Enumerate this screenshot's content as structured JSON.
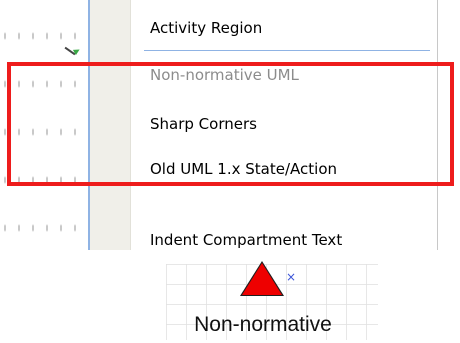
{
  "menu": {
    "items": [
      {
        "label": "Activity Region",
        "enabled": true
      },
      {
        "label": "Non-normative UML",
        "enabled": false
      },
      {
        "label": "Sharp Corners",
        "enabled": true
      },
      {
        "label": "Old UML 1.x State/Action",
        "enabled": true
      },
      {
        "label": "Indent Compartment Text",
        "enabled": true
      }
    ]
  },
  "highlight": {
    "color": "#ee1c1c"
  },
  "preview": {
    "label": "Non-normative",
    "shape_color": "#ee0000",
    "anchor_marker": "×"
  },
  "colors": {
    "accent": "#8fb3e4",
    "gutter": "#f0efe9",
    "disabled_text": "#8c8c8c"
  }
}
